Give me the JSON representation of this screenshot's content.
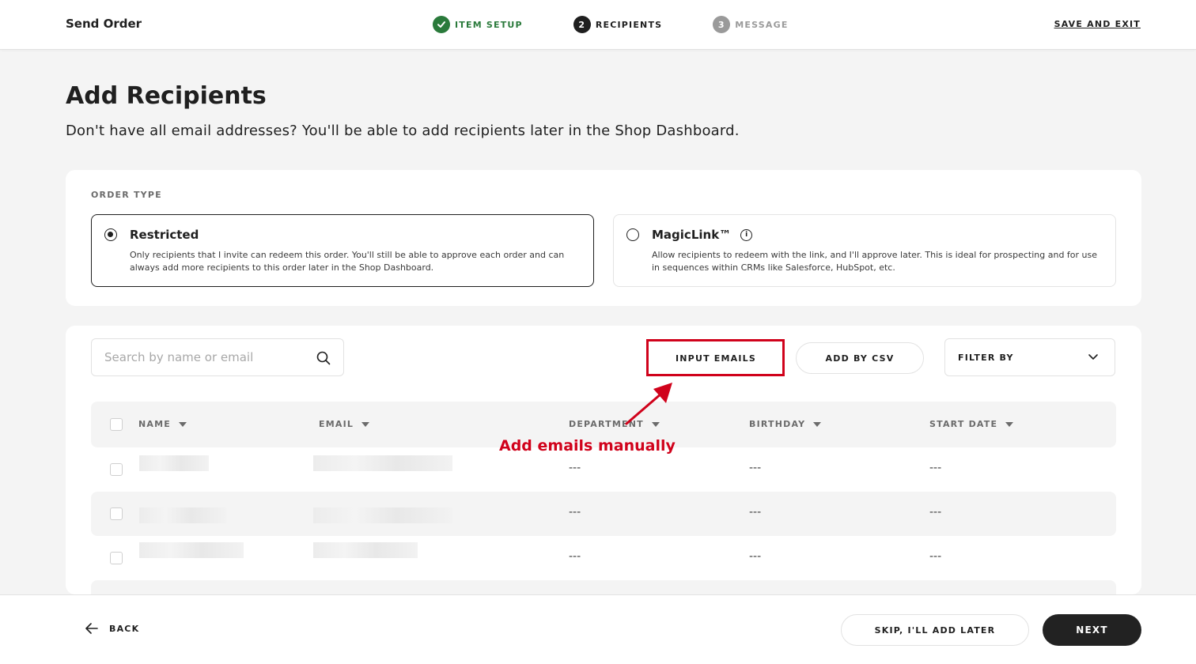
{
  "header": {
    "title": "Send Order",
    "steps": [
      {
        "number": "✓",
        "label": "ITEM SETUP",
        "state": "done"
      },
      {
        "number": "2",
        "label": "RECIPIENTS",
        "state": "active"
      },
      {
        "number": "3",
        "label": "MESSAGE",
        "state": "todo"
      }
    ],
    "save_exit": "SAVE AND EXIT"
  },
  "page": {
    "title": "Add Recipients",
    "subtitle": "Don't have all email addresses? You'll be able to add recipients later in the Shop Dashboard."
  },
  "order_type": {
    "label": "ORDER TYPE",
    "options": [
      {
        "title": "Restricted",
        "selected": true,
        "description": "Only recipients that I invite can redeem this order. You'll still be able to approve each order and can always add more recipients to this order later in the Shop Dashboard."
      },
      {
        "title": "MagicLink™",
        "selected": false,
        "info_icon": "info-icon",
        "description": "Allow recipients to redeem with the link, and I'll approve later. This is ideal for prospecting and for use in sequences within CRMs like Salesforce, HubSpot, etc."
      }
    ]
  },
  "recipients": {
    "search_placeholder": "Search by name or email",
    "input_emails": "INPUT EMAILS",
    "add_csv": "ADD BY CSV",
    "filter_label": "FILTER BY",
    "columns": [
      "NAME",
      "EMAIL",
      "DEPARTMENT",
      "BIRTHDAY",
      "START DATE"
    ],
    "rows": [
      {
        "department": "---",
        "birthday": "---",
        "start_date": "---"
      },
      {
        "department": "---",
        "birthday": "---",
        "start_date": "---"
      },
      {
        "department": "---",
        "birthday": "---",
        "start_date": "---"
      }
    ]
  },
  "annotation": {
    "text": "Add emails manually",
    "color": "#d0021b"
  },
  "footer": {
    "back": "BACK",
    "skip": "SKIP, I'LL ADD LATER",
    "next": "NEXT"
  },
  "colors": {
    "accent_green": "#2a7a3b",
    "dark": "#1f1f1f",
    "muted": "#9a9a9a"
  }
}
